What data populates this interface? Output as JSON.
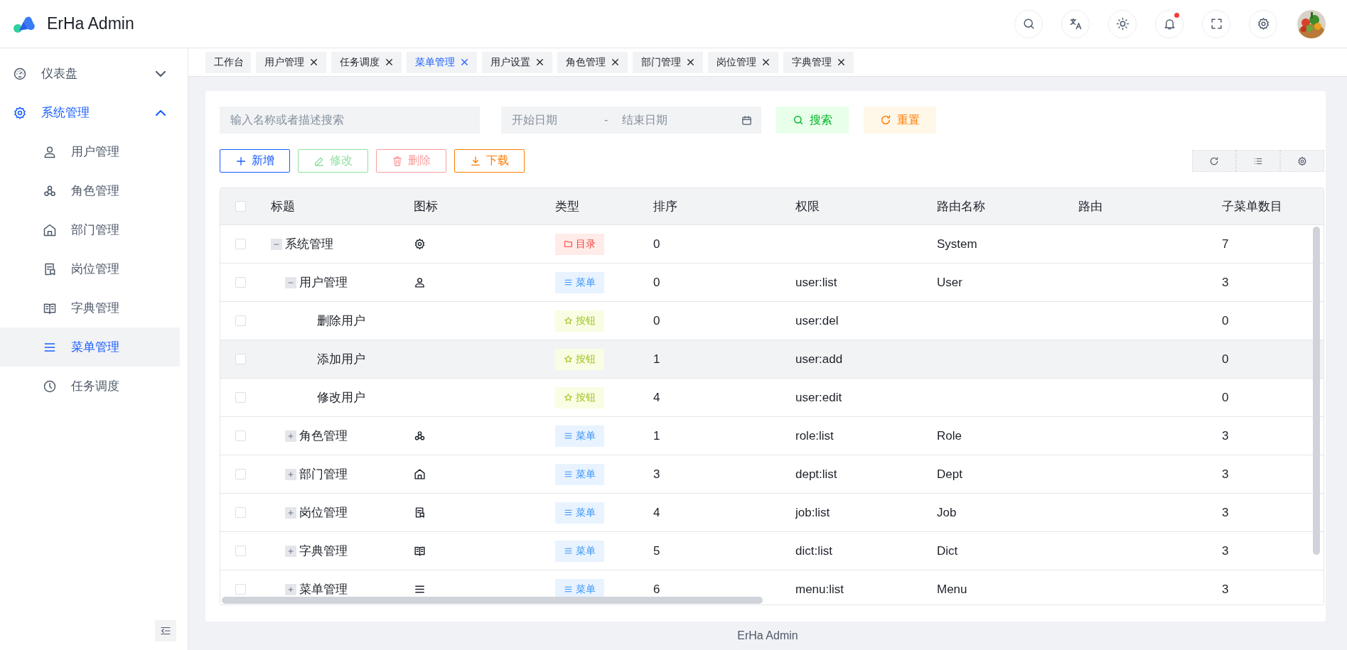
{
  "header": {
    "title": "ErHa Admin",
    "actions": [
      {
        "kind": "search"
      },
      {
        "kind": "translate"
      },
      {
        "kind": "theme"
      },
      {
        "kind": "bell",
        "unread": true
      },
      {
        "kind": "fullscreen"
      },
      {
        "kind": "settings"
      }
    ]
  },
  "sidebar": {
    "items": [
      {
        "label": "仪表盘",
        "kind": "gauge",
        "expanded": false
      },
      {
        "label": "系统管理",
        "kind": "gear",
        "expanded": true,
        "children": [
          {
            "label": "用户管理",
            "kind": "user",
            "selected": false
          },
          {
            "label": "角色管理",
            "kind": "role",
            "selected": false
          },
          {
            "label": "部门管理",
            "kind": "house",
            "selected": false
          },
          {
            "label": "岗位管理",
            "kind": "doc",
            "selected": false
          },
          {
            "label": "字典管理",
            "kind": "book",
            "selected": false
          },
          {
            "label": "菜单管理",
            "kind": "list",
            "selected": true
          },
          {
            "label": "任务调度",
            "kind": "clock",
            "selected": false
          }
        ]
      }
    ]
  },
  "tabs": [
    {
      "label": "工作台",
      "closable": false,
      "selected": false
    },
    {
      "label": "用户管理",
      "closable": true,
      "selected": false
    },
    {
      "label": "任务调度",
      "closable": true,
      "selected": false
    },
    {
      "label": "菜单管理",
      "closable": true,
      "selected": true
    },
    {
      "label": "用户设置",
      "closable": true,
      "selected": false
    },
    {
      "label": "角色管理",
      "closable": true,
      "selected": false
    },
    {
      "label": "部门管理",
      "closable": true,
      "selected": false
    },
    {
      "label": "岗位管理",
      "closable": true,
      "selected": false
    },
    {
      "label": "字典管理",
      "closable": true,
      "selected": false
    }
  ],
  "search": {
    "keyword": {
      "placeholder": "输入名称或者描述搜索"
    },
    "date_range": {
      "start_placeholder": "开始日期",
      "separator": "-",
      "end_placeholder": "结束日期"
    },
    "buttons": [
      {
        "kind": "search",
        "label": "搜索"
      },
      {
        "kind": "reset",
        "label": "重置"
      }
    ]
  },
  "actions": [
    {
      "kind": "add",
      "label": "新增",
      "disabled": false
    },
    {
      "kind": "edit",
      "label": "修改",
      "disabled": true
    },
    {
      "kind": "delete",
      "label": "删除",
      "disabled": true
    },
    {
      "kind": "download",
      "label": "下载",
      "disabled": false
    }
  ],
  "table_tools": [
    {
      "kind": "refresh"
    },
    {
      "kind": "columns"
    },
    {
      "kind": "settings"
    }
  ],
  "table": {
    "columns": [
      "标题",
      "图标",
      "类型",
      "排序",
      "权限",
      "路由名称",
      "路由",
      "子菜单数目"
    ],
    "header_checked": false,
    "rows": [
      {
        "title": "系统管理",
        "kind": "gear",
        "type": {
          "kind": "directory",
          "label": "目录"
        },
        "sort": "0",
        "route_name": "System",
        "child_count": "7",
        "checked": false,
        "hovered": false,
        "expanded": true,
        "children": [
          {
            "title": "用户管理",
            "kind": "user",
            "type": {
              "kind": "menu",
              "label": "菜单"
            },
            "sort": "0",
            "permission": "user:list",
            "route_name": "User",
            "child_count": "3",
            "checked": false,
            "hovered": false,
            "expanded": true,
            "children": [
              {
                "title": "删除用户",
                "type": {
                  "kind": "button",
                  "label": "按钮"
                },
                "sort": "0",
                "permission": "user:del",
                "child_count": "0",
                "checked": false,
                "hovered": false
              },
              {
                "title": "添加用户",
                "type": {
                  "kind": "button",
                  "label": "按钮"
                },
                "sort": "1",
                "permission": "user:add",
                "child_count": "0",
                "checked": false,
                "hovered": true
              },
              {
                "title": "修改用户",
                "type": {
                  "kind": "button",
                  "label": "按钮"
                },
                "sort": "4",
                "permission": "user:edit",
                "child_count": "0",
                "checked": false,
                "hovered": false
              }
            ]
          },
          {
            "title": "角色管理",
            "kind": "role",
            "type": {
              "kind": "menu",
              "label": "菜单"
            },
            "sort": "1",
            "permission": "role:list",
            "route_name": "Role",
            "child_count": "3",
            "checked": false,
            "hovered": false,
            "expanded": false
          },
          {
            "title": "部门管理",
            "kind": "house",
            "type": {
              "kind": "menu",
              "label": "菜单"
            },
            "sort": "3",
            "permission": "dept:list",
            "route_name": "Dept",
            "child_count": "3",
            "checked": false,
            "hovered": false,
            "expanded": false
          },
          {
            "title": "岗位管理",
            "kind": "doc",
            "type": {
              "kind": "menu",
              "label": "菜单"
            },
            "sort": "4",
            "permission": "job:list",
            "route_name": "Job",
            "child_count": "3",
            "checked": false,
            "hovered": false,
            "expanded": false
          },
          {
            "title": "字典管理",
            "kind": "book",
            "type": {
              "kind": "menu",
              "label": "菜单"
            },
            "sort": "5",
            "permission": "dict:list",
            "route_name": "Dict",
            "child_count": "3",
            "checked": false,
            "hovered": false,
            "expanded": false
          },
          {
            "title": "菜单管理",
            "kind": "list",
            "type": {
              "kind": "menu",
              "label": "菜单"
            },
            "sort": "6",
            "permission": "menu:list",
            "route_name": "Menu",
            "child_count": "3",
            "checked": false,
            "hovered": false,
            "expanded": false
          }
        ]
      }
    ]
  },
  "footer": {
    "text": "ErHa Admin"
  }
}
